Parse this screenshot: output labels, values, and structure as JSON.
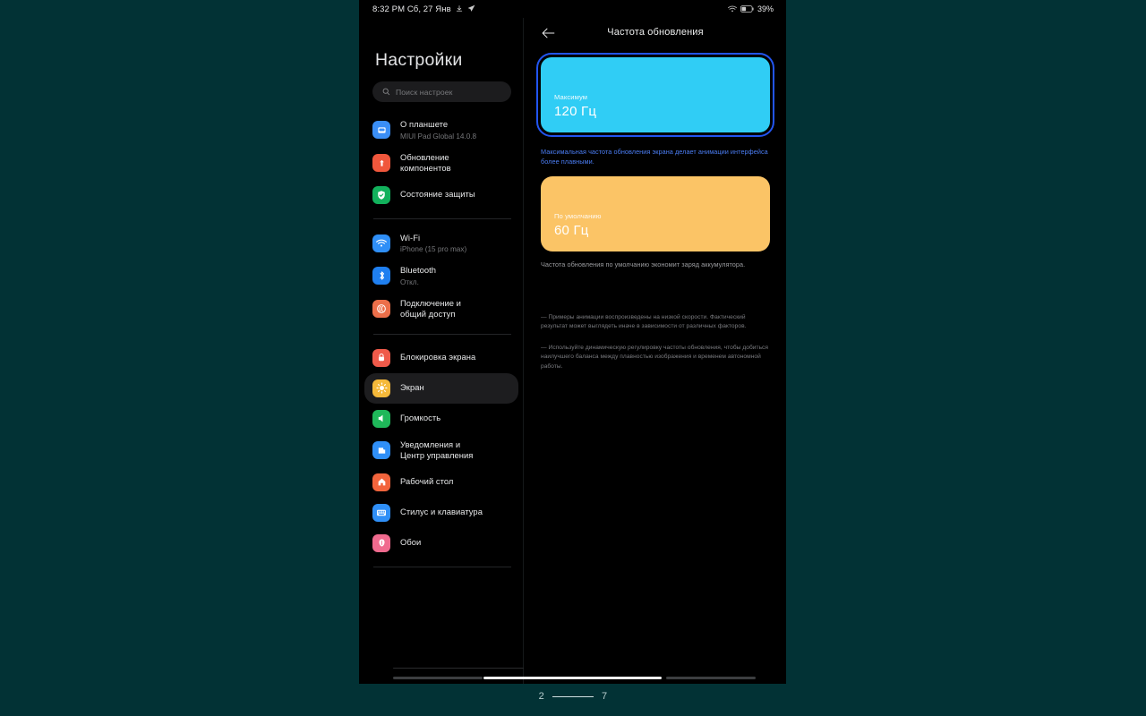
{
  "statusbar": {
    "time": "8:32 PM Сб, 27 Янв",
    "download_icon": "download-icon",
    "telegram_icon": "send-icon",
    "wifi_icon": "wifi-icon",
    "battery_icon": "battery-icon",
    "battery_text": "39%"
  },
  "sidebar": {
    "title": "Настройки",
    "search_placeholder": "Поиск настроек",
    "search_icon": "search-icon",
    "items": [
      {
        "label": "О планшете",
        "sub": "MIUI Pad Global 14.0.8",
        "icon": "tablet-icon",
        "color": "#3a8ef6",
        "active": false,
        "divider_after": false
      },
      {
        "label": "Обновление\nкомпонентов",
        "sub": "",
        "icon": "upload-arrow-icon",
        "color": "#f0573c",
        "active": false,
        "divider_after": false
      },
      {
        "label": "Состояние защиты",
        "sub": "",
        "icon": "shield-check-icon",
        "color": "#12b15c",
        "active": false,
        "divider_after": true
      },
      {
        "label": "Wi-Fi",
        "sub": "iPhone (15 pro max)",
        "icon": "wifi-icon",
        "color": "#2f8ff7",
        "active": false,
        "divider_after": false
      },
      {
        "label": "Bluetooth",
        "sub": "Откл.",
        "icon": "bluetooth-icon",
        "color": "#1f7ff0",
        "active": false,
        "divider_after": false
      },
      {
        "label": "Подключение и\nобщий доступ",
        "sub": "",
        "icon": "share-connect-icon",
        "color": "#ec6f4a",
        "active": false,
        "divider_after": true
      },
      {
        "label": "Блокировка экрана",
        "sub": "",
        "icon": "lock-icon",
        "color": "#ef5a4a",
        "active": false,
        "divider_after": false
      },
      {
        "label": "Экран",
        "sub": "",
        "icon": "brightness-sun-icon",
        "color": "#f5b93a",
        "active": true,
        "divider_after": false
      },
      {
        "label": "Громкость",
        "sub": "",
        "icon": "speaker-icon",
        "color": "#1fb85a",
        "active": false,
        "divider_after": false
      },
      {
        "label": "Уведомления и\nЦентр управления",
        "sub": "",
        "icon": "notification-icon",
        "color": "#2f8ff7",
        "active": false,
        "divider_after": false
      },
      {
        "label": "Рабочий стол",
        "sub": "",
        "icon": "home-icon",
        "color": "#f2643c",
        "active": false,
        "divider_after": false
      },
      {
        "label": "Стилус и клавиатура",
        "sub": "",
        "icon": "keyboard-icon",
        "color": "#2f8ff7",
        "active": false,
        "divider_after": false
      },
      {
        "label": "Обои",
        "sub": "",
        "icon": "wallpaper-flower-icon",
        "color": "#f06a8e",
        "active": false,
        "divider_after": true
      }
    ]
  },
  "detail": {
    "back_icon": "back-arrow-icon",
    "title": "Частота обновления",
    "cards": [
      {
        "sub": "Максимум",
        "value": "120 Гц",
        "selected": true,
        "fill": "#30cdf5",
        "outline": "#2255f0",
        "helper": "Максимальная частота обновления экрана делает анимации интерфейса более плавными.",
        "helper_color": "#4b7ef5"
      },
      {
        "sub": "По умолчанию",
        "value": "60 Гц",
        "selected": false,
        "fill": "#fbc466",
        "outline": "",
        "helper": "Частота обновления по умолчанию экономит заряд аккумулятора.",
        "helper_color": "#9b9ca0"
      }
    ],
    "notes": [
      "— Примеры анимации воспроизведены на низкой скорости. Фактический результат может выглядеть иначе в зависимости от различных факторов.",
      "— Используйте динамическую регулировку частоты обновления, чтобы добиться наилучшего баланса между плавностью изображения и временем автономной работы."
    ]
  },
  "pager": {
    "current": "2",
    "total": "7"
  }
}
